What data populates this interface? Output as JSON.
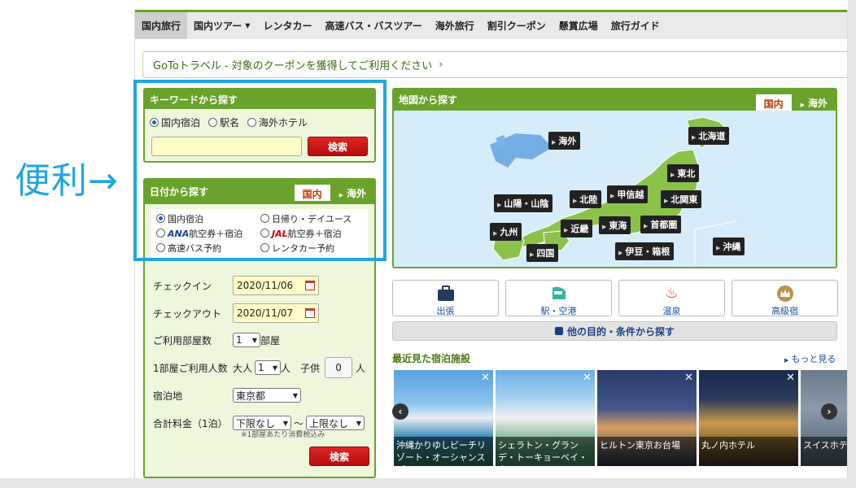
{
  "nav": {
    "items": [
      {
        "label": "国内旅行",
        "active": true
      },
      {
        "label": "国内ツアー",
        "has_dropdown": true
      },
      {
        "label": "レンタカー"
      },
      {
        "label": "高速バス・バスツアー"
      },
      {
        "label": "海外旅行"
      },
      {
        "label": "割引クーポン"
      },
      {
        "label": "懸賞広場"
      },
      {
        "label": "旅行ガイド"
      }
    ]
  },
  "banner": {
    "text": "GoToトラベル - 対象のクーポンを獲得してご利用ください",
    "arrow": "›"
  },
  "annotation": {
    "text": "便利→"
  },
  "keyword_panel": {
    "title": "キーワードから探す",
    "options": [
      "国内宿泊",
      "駅名",
      "海外ホテル"
    ],
    "selected": "国内宿泊",
    "input_value": "",
    "search_label": "検索"
  },
  "date_panel": {
    "title": "日付から探す",
    "tab_domestic": "国内",
    "tab_overseas": "海外",
    "options": {
      "o1": "国内宿泊",
      "o2": "日帰り・デイユース",
      "o3_brand": "ANA",
      "o3_text": "航空券＋宿泊",
      "o4_brand": "JAL",
      "o4_text": "航空券＋宿泊",
      "o5": "高速バス予約",
      "o6": "レンタカー予約"
    },
    "checkin_label": "チェックイン",
    "checkin_value": "2020/11/06",
    "checkout_label": "チェックアウト",
    "checkout_value": "2020/11/07",
    "rooms_label": "ご利用部屋数",
    "rooms_value": "1",
    "rooms_unit": "部屋",
    "people_label": "1部屋ご利用人数",
    "adult_label": "大人",
    "adult_value": "1",
    "adult_unit": "人",
    "child_label": "子供",
    "child_value": "0",
    "child_unit": "人",
    "dest_label": "宿泊地",
    "dest_value": "東京都",
    "price_label": "合計料金（1泊）",
    "price_min": "下限なし",
    "price_sep": "〜",
    "price_max": "上限なし",
    "note": "※1部屋あたり消費税込み",
    "search_label": "検索"
  },
  "map_panel": {
    "title": "地図から探す",
    "tab_domestic": "国内",
    "tab_overseas": "海外",
    "regions": {
      "overseas": "海外",
      "hokkaido": "北海道",
      "tohoku": "東北",
      "hokuriku": "北陸",
      "koshinetsu": "甲信越",
      "kitakanto": "北関東",
      "sanin": "山陽・山陰",
      "kinki": "近畿",
      "tokai": "東海",
      "shutoken": "首都圏",
      "kyushu": "九州",
      "shikoku": "四国",
      "izu": "伊豆・箱根",
      "okinawa": "沖縄"
    }
  },
  "categories": [
    "出張",
    "駅・空港",
    "温泉",
    "高級宿"
  ],
  "more_conditions": "他の目的・条件から探す",
  "recent": {
    "title": "最近見た宿泊施設",
    "more": "もっと見る",
    "hotels": [
      "沖縄かりゆしビーチリゾート・オーシャンスパ",
      "シェラトン・グランデ・トーキョーベイ・ホテル",
      "ヒルトン東京お台場",
      "丸ノ内ホテル",
      "スイスホテル"
    ]
  },
  "colors": {
    "brand_green": "#6aa32c",
    "search_red": "#c8161b",
    "annotation_blue": "#1ea6e0",
    "map_land": "#8bc34a"
  }
}
